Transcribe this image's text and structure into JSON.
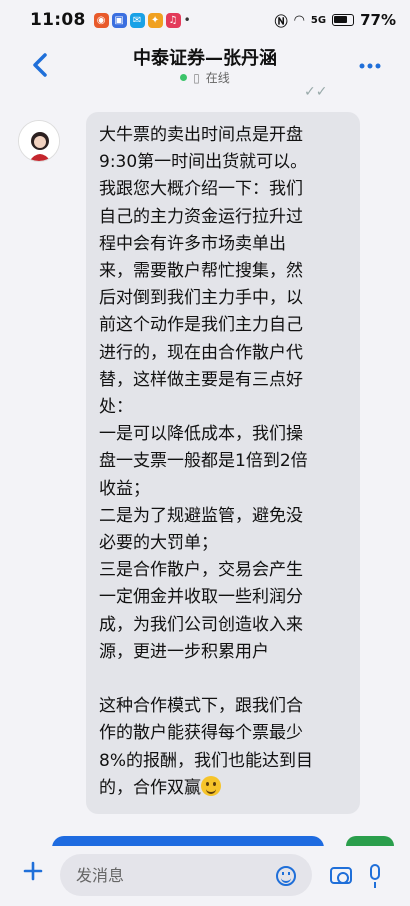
{
  "status_bar": {
    "time": "11:08",
    "network": "5G",
    "battery": "77%"
  },
  "header": {
    "title": "中泰证券—张丹涵",
    "presence": "在线"
  },
  "message": {
    "lines": [
      "大牛票的卖出时间点是开盘",
      "9:30第一时间出货就可以。",
      "我跟您大概介绍一下：我们",
      "自己的主力资金运行拉升过",
      "程中会有许多市场卖单出",
      "来，需要散户帮忙搜集，然",
      "后对倒到我们主力手中，以",
      "前这个动作是我们主力自己",
      "进行的，现在由合作散户代",
      "替，这样做主要是有三点好",
      "处：",
      "一是可以降低成本，我们操",
      "盘一支票一般都是1倍到2倍",
      "收益；",
      "二是为了规避监管，避免没",
      "必要的大罚单；",
      "三是合作散户，交易会产生",
      "一定佣金并收取一些利润分",
      "成，为我们公司创造收入来",
      "源，更进一步积累用户",
      "",
      "这种合作模式下，跟我们合",
      "作的散户能获得每个票最少",
      "8%的报酬，我们也能达到目",
      "的，合作双赢"
    ]
  },
  "input": {
    "placeholder": "发消息"
  },
  "colors": {
    "accent": "#1f6fd9",
    "bubble": "#e3e4e9",
    "online": "#3cc46a"
  }
}
